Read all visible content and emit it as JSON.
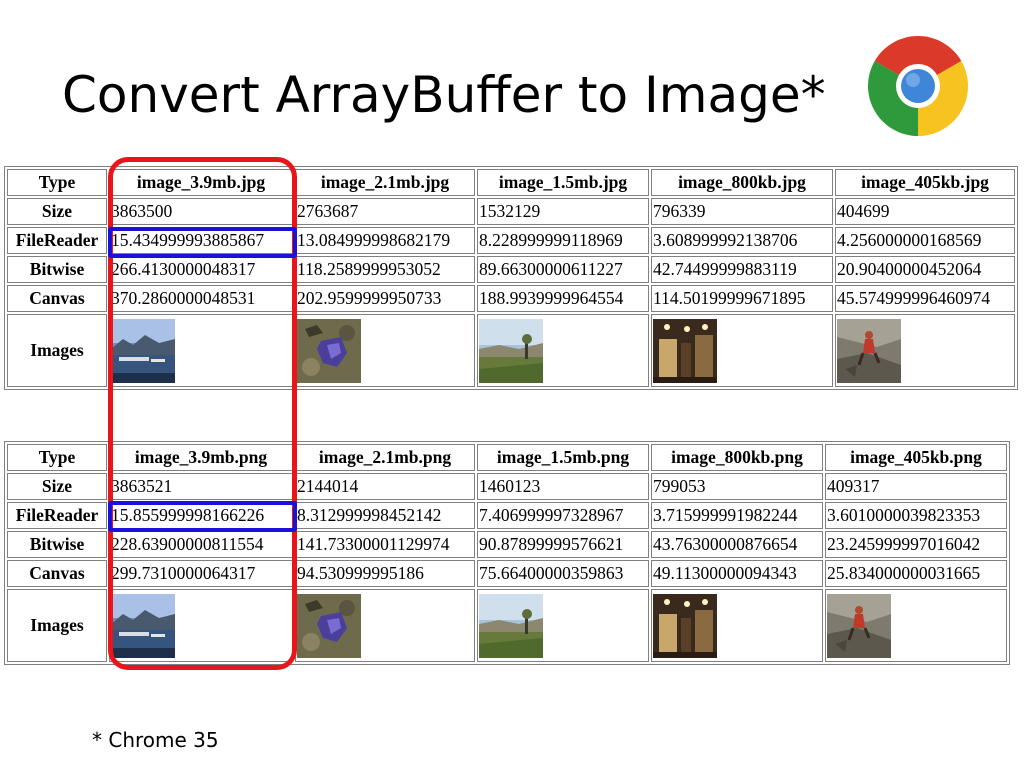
{
  "slide": {
    "title": "Convert ArrayBuffer to Image*",
    "footnote": "* Chrome 35",
    "logo_icon": "chrome-logo-icon"
  },
  "colors": {
    "red_highlight": "#e8151b",
    "blue_highlight": "#1a12d8",
    "table_border": "#808080"
  },
  "row_labels": {
    "type": "Type",
    "size": "Size",
    "filereader": "FileReader",
    "bitwise": "Bitwise",
    "canvas": "Canvas",
    "images": "Images"
  },
  "jpg_table": {
    "columns": [
      {
        "type": "image_3.9mb.jpg",
        "size": "3863500",
        "filereader": "15.434999993885867",
        "bitwise": "266.4130000048317",
        "canvas": "370.2860000048531",
        "thumb": "harbor"
      },
      {
        "type": "image_2.1mb.jpg",
        "size": "2763687",
        "filereader": "13.084999998682179",
        "bitwise": "118.2589999953052",
        "canvas": "202.9599999950733",
        "thumb": "rock"
      },
      {
        "type": "image_1.5mb.jpg",
        "size": "1532129",
        "filereader": "8.228999999118969",
        "bitwise": "89.66300000611227",
        "canvas": "188.9939999964554",
        "thumb": "field"
      },
      {
        "type": "image_800kb.jpg",
        "size": "796339",
        "filereader": "3.608999992138706",
        "bitwise": "42.74499999883119",
        "canvas": "114.50199999671895",
        "thumb": "room"
      },
      {
        "type": "image_405kb.jpg",
        "size": "404699",
        "filereader": "4.256000000168569",
        "bitwise": "20.90400000452064",
        "canvas": "45.574999996460974",
        "thumb": "climber"
      }
    ]
  },
  "png_table": {
    "columns": [
      {
        "type": "image_3.9mb.png",
        "size": "3863521",
        "filereader": "15.855999998166226",
        "bitwise": "228.63900000811554",
        "canvas": "299.7310000064317",
        "thumb": "harbor"
      },
      {
        "type": "image_2.1mb.png",
        "size": "2144014",
        "filereader": "8.312999998452142",
        "bitwise": "141.73300001129974",
        "canvas": "94.530999995186",
        "thumb": "rock"
      },
      {
        "type": "image_1.5mb.png",
        "size": "1460123",
        "filereader": "7.406999997328967",
        "bitwise": "90.87899999576621",
        "canvas": "75.66400000359863",
        "thumb": "field"
      },
      {
        "type": "image_800kb.png",
        "size": "799053",
        "filereader": "3.715999991982244",
        "bitwise": "43.76300000876654",
        "canvas": "49.11300000094343",
        "thumb": "room"
      },
      {
        "type": "image_405kb.png",
        "size": "409317",
        "filereader": "3.6010000039823353",
        "bitwise": "23.245999997016042",
        "canvas": "25.834000000031665",
        "thumb": "climber"
      }
    ]
  }
}
